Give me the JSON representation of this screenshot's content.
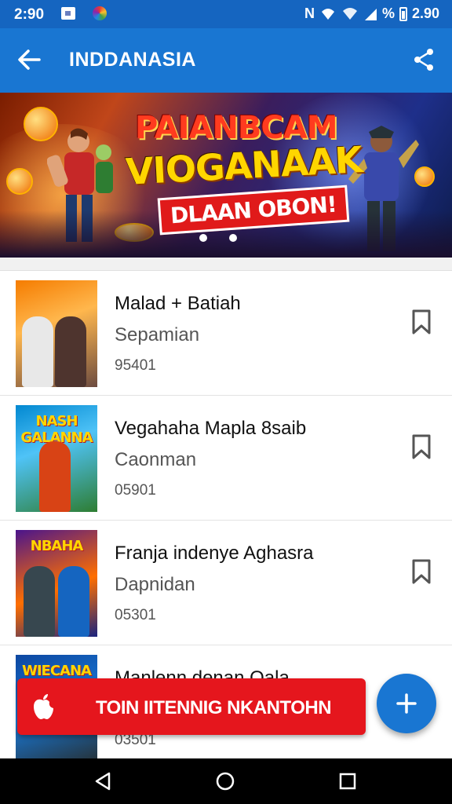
{
  "status_bar": {
    "time": "2:90",
    "right_text": "N",
    "percent": "%",
    "right_time": "2.90"
  },
  "app_bar": {
    "title": "INDDANASIA"
  },
  "banner": {
    "headline_line1": "PAIANBCAM",
    "headline_line2": "VIOGANAAK",
    "tag": "DLAAN OBON!",
    "page_count": 2
  },
  "items": [
    {
      "name": "Malad + Batiah",
      "subtitle": "Sepamian",
      "number": "95401",
      "thumb_label": "",
      "icon": "bookmark-icon"
    },
    {
      "name": "Vegahaha Mapla 8saib",
      "subtitle": "Caonman",
      "number": "05901",
      "thumb_label": "NASH GALANNA",
      "icon": "bookmark-icon"
    },
    {
      "name": "Franja indenye Aghasra",
      "subtitle": "Dapnidan",
      "number": "05301",
      "thumb_label": "NBAHA",
      "icon": "bookmark-icon"
    },
    {
      "name": "Manlenn denan Oala",
      "subtitle": "",
      "number": "03501",
      "thumb_label": "WIECANA",
      "icon": "bookmark-icon"
    }
  ],
  "cta": {
    "label": "TOIN IITENNIG NKANTOHN",
    "icon": "apple-icon"
  },
  "fab": {
    "icon": "plus-icon"
  },
  "nav": {
    "back": "back-triangle-icon",
    "home": "home-circle-icon",
    "recents": "recents-square-icon"
  },
  "colors": {
    "primary": "#1976d2",
    "status": "#1565c0",
    "cta": "#e5161d"
  }
}
